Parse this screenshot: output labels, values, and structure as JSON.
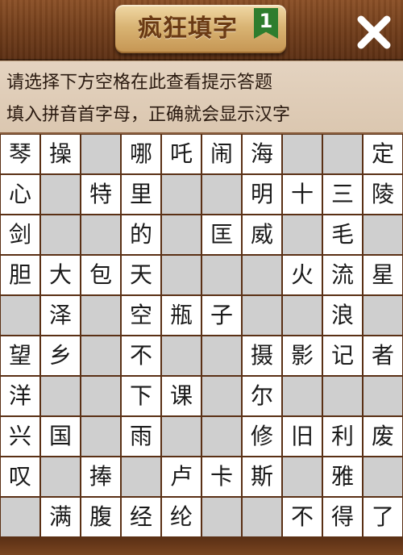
{
  "header": {
    "title": "疯狂填字",
    "level": "1",
    "close_icon": "close-icon"
  },
  "hint": {
    "line1": "请选择下方空格在此查看提示答题",
    "line2": "填入拼音首字母，正确就会显示汉字"
  },
  "colors": {
    "wood": "#6b3a1b",
    "plaque": "#d9b474",
    "ribbon": "#2e7d2e",
    "filled_cell": "#ffffff",
    "empty_cell": "#cfcfcf"
  },
  "grid": [
    [
      "琴",
      "操",
      "",
      "哪",
      "吒",
      "闹",
      "海",
      "",
      "",
      "定"
    ],
    [
      "心",
      "",
      "特",
      "里",
      "",
      "",
      "明",
      "十",
      "三",
      "陵"
    ],
    [
      "剑",
      "",
      "",
      "的",
      "",
      "匡",
      "威",
      "",
      "毛",
      ""
    ],
    [
      "胆",
      "大",
      "包",
      "天",
      "",
      "",
      "",
      "火",
      "流",
      "星"
    ],
    [
      "",
      "泽",
      "",
      "空",
      "瓶",
      "子",
      "",
      "",
      "浪",
      ""
    ],
    [
      "望",
      "乡",
      "",
      "不",
      "",
      "",
      "摄",
      "影",
      "记",
      "者"
    ],
    [
      "洋",
      "",
      "",
      "下",
      "课",
      "",
      "尔",
      "",
      "",
      ""
    ],
    [
      "兴",
      "国",
      "",
      "雨",
      "",
      "",
      "修",
      "旧",
      "利",
      "废"
    ],
    [
      "叹",
      "",
      "捧",
      "",
      "卢",
      "卡",
      "斯",
      "",
      "雅",
      ""
    ],
    [
      "",
      "满",
      "腹",
      "经",
      "纶",
      "",
      "",
      "不",
      "得",
      "了"
    ]
  ]
}
